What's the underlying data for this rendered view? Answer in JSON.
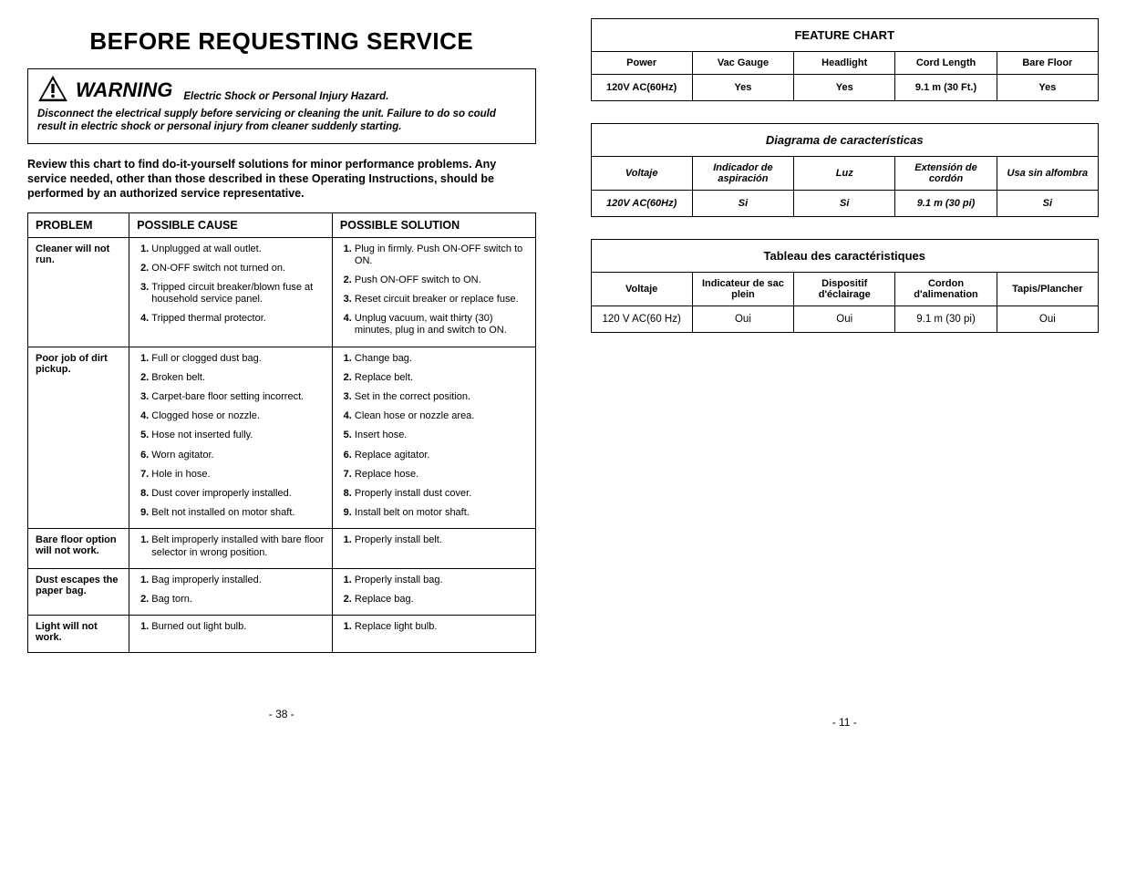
{
  "left": {
    "title": "BEFORE REQUESTING SERVICE",
    "warning_word": "WARNING",
    "warning_sub": "Electric Shock or Personal Injury Hazard.",
    "warning_body": "Disconnect the electrical supply before servicing or cleaning the unit. Failure to do so could result in electric shock or personal injury from cleaner suddenly starting.",
    "intro": "Review this chart to find do-it-yourself solutions for minor performance problems. Any service needed, other than those described in these Operating Instructions, should be performed by an authorized service representative.",
    "headers": {
      "problem": "PROBLEM",
      "cause": "POSSIBLE CAUSE",
      "solution": "POSSIBLE SOLUTION"
    },
    "rows": [
      {
        "problem": "Cleaner will not run.",
        "causes": [
          "Unplugged at wall outlet.",
          "ON-OFF switch not turned on.",
          "Tripped circuit breaker/blown fuse at household service panel.",
          "Tripped thermal protector."
        ],
        "solutions": [
          "Plug in firmly. Push ON-OFF switch to ON.",
          "Push ON-OFF switch to ON.",
          "Reset circuit breaker or replace fuse.",
          "Unplug vacuum, wait thirty (30) minutes, plug in and switch to ON."
        ]
      },
      {
        "problem": "Poor job of dirt pickup.",
        "causes": [
          "Full or clogged dust bag.",
          "Broken belt.",
          "Carpet-bare floor setting incorrect.",
          "Clogged hose or nozzle.",
          "Hose not inserted fully.",
          "Worn agitator.",
          "Hole in hose.",
          "Dust cover improperly installed.",
          "Belt not installed on motor shaft."
        ],
        "solutions": [
          "Change bag.",
          "Replace belt.",
          "Set in the correct position.",
          "Clean hose or nozzle area.",
          "Insert hose.",
          "Replace agitator.",
          "Replace hose.",
          "Properly install dust cover.",
          "Install belt on motor shaft."
        ]
      },
      {
        "problem": "Bare floor option will not work.",
        "causes": [
          "Belt improperly installed with bare floor selector in wrong position."
        ],
        "solutions": [
          "Properly install belt."
        ]
      },
      {
        "problem": "Dust escapes the paper bag.",
        "causes": [
          "Bag improperly installed.",
          "Bag torn."
        ],
        "solutions": [
          "Properly install bag.",
          "Replace bag."
        ]
      },
      {
        "problem": "Light will not work.",
        "causes": [
          "Burned out light bulb."
        ],
        "solutions": [
          "Replace light bulb."
        ]
      }
    ],
    "page": "- 38 -"
  },
  "right": {
    "tables": [
      {
        "class": "",
        "caption": "FEATURE CHART",
        "headers": [
          "Power",
          "Vac Gauge",
          "Headlight",
          "Cord Length",
          "Bare Floor"
        ],
        "row": [
          "120V AC(60Hz)",
          "Yes",
          "Yes",
          "9.1 m (30 Ft.)",
          "Yes"
        ]
      },
      {
        "class": "it",
        "caption": "Diagrama de características",
        "headers": [
          "Voltaje",
          "Indicador de aspiración",
          "Luz",
          "Extensión de cordón",
          "Usa sin alfombra"
        ],
        "row": [
          "120V AC(60Hz)",
          "Si",
          "Si",
          "9.1 m  (30 pi)",
          "Si"
        ]
      },
      {
        "class": "fr",
        "caption": "Tableau des caractéristiques",
        "headers": [
          "Voltaje",
          "Indicateur de sac plein",
          "Dispositif d'éclairage",
          "Cordon d'alimenation",
          "Tapis/Plancher"
        ],
        "row": [
          "120 V AC(60 Hz)",
          "Oui",
          "Oui",
          "9.1 m  (30 pi)",
          "Oui"
        ]
      }
    ],
    "page": "- 11 -"
  }
}
